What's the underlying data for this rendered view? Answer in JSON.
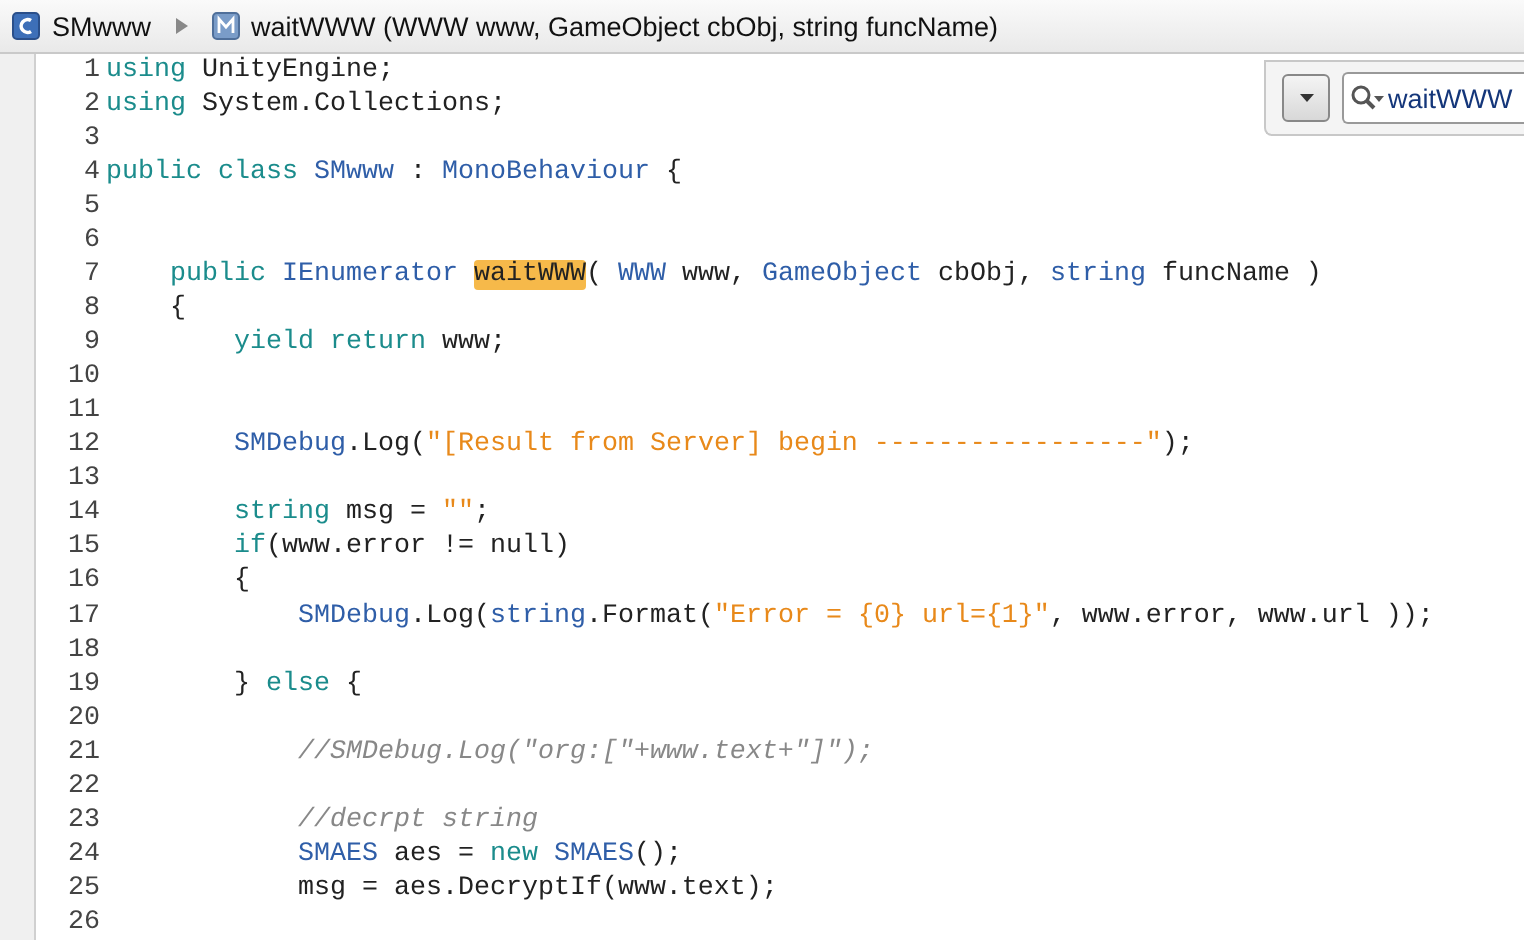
{
  "breadcrumb": {
    "class_name": "SMwww",
    "method_signature": "waitWWW (WWW www, GameObject cbObj, string funcName)"
  },
  "search": {
    "value": "waitWWW"
  },
  "lines": [
    {
      "number": "1",
      "tokens": [
        {
          "text": "using",
          "kind": "keyword"
        },
        {
          "text": " UnityEngine;",
          "kind": "plain"
        }
      ]
    },
    {
      "number": "2",
      "tokens": [
        {
          "text": "using",
          "kind": "keyword"
        },
        {
          "text": " System.Collections;",
          "kind": "plain"
        }
      ]
    },
    {
      "number": "3"
    },
    {
      "number": "4",
      "tokens": [
        {
          "text": "public class ",
          "kind": "keyword"
        },
        {
          "text": "SMwww",
          "kind": "type"
        },
        {
          "text": " : ",
          "kind": "plain"
        },
        {
          "text": "MonoBehaviour",
          "kind": "type"
        },
        {
          "text": " {",
          "kind": "plain"
        }
      ]
    },
    {
      "number": "5"
    },
    {
      "number": "6"
    },
    {
      "number": "7",
      "tokens": [
        {
          "text": "    public ",
          "kind": "keyword"
        },
        {
          "text": "IEnumerator ",
          "kind": "type"
        },
        {
          "text": "waitWWW",
          "kind": "match"
        },
        {
          "text": "( ",
          "kind": "plain"
        },
        {
          "text": "WWW",
          "kind": "type"
        },
        {
          "text": " www, ",
          "kind": "plain"
        },
        {
          "text": "GameObject",
          "kind": "type"
        },
        {
          "text": " cbObj, ",
          "kind": "plain"
        },
        {
          "text": "string",
          "kind": "type"
        },
        {
          "text": " funcName )",
          "kind": "plain"
        }
      ]
    },
    {
      "number": "8",
      "tokens": [
        {
          "text": "    {",
          "kind": "plain"
        }
      ]
    },
    {
      "number": "9",
      "tokens": [
        {
          "text": "        yield return",
          "kind": "keyword"
        },
        {
          "text": " www;",
          "kind": "plain"
        }
      ]
    },
    {
      "number": "10"
    },
    {
      "number": "11"
    },
    {
      "number": "12",
      "tokens": [
        {
          "text": "        SMDebug",
          "kind": "type"
        },
        {
          "text": ".Log(",
          "kind": "plain"
        },
        {
          "text": "\"[Result from Server] begin -----------------\"",
          "kind": "string"
        },
        {
          "text": ");",
          "kind": "plain"
        }
      ]
    },
    {
      "number": "13"
    },
    {
      "number": "14",
      "tokens": [
        {
          "text": "        string",
          "kind": "keyword"
        },
        {
          "text": " msg = ",
          "kind": "plain"
        },
        {
          "text": "\"\"",
          "kind": "string"
        },
        {
          "text": ";",
          "kind": "plain"
        }
      ]
    },
    {
      "number": "15",
      "tokens": [
        {
          "text": "        if",
          "kind": "keyword"
        },
        {
          "text": "(www.error != null)",
          "kind": "plain"
        }
      ]
    },
    {
      "number": "16",
      "tokens": [
        {
          "text": "        {",
          "kind": "plain"
        }
      ]
    },
    {
      "number": "17",
      "tokens": [
        {
          "text": "            SMDebug",
          "kind": "type"
        },
        {
          "text": ".Log(",
          "kind": "plain"
        },
        {
          "text": "string",
          "kind": "type"
        },
        {
          "text": ".Format(",
          "kind": "plain"
        },
        {
          "text": "\"Error = {0} url={1}\"",
          "kind": "string"
        },
        {
          "text": ", www.error, www.url ));",
          "kind": "plain"
        }
      ]
    },
    {
      "number": "18"
    },
    {
      "number": "19",
      "tokens": [
        {
          "text": "        } ",
          "kind": "plain"
        },
        {
          "text": "else",
          "kind": "keyword"
        },
        {
          "text": " {",
          "kind": "plain"
        }
      ]
    },
    {
      "number": "20"
    },
    {
      "number": "21",
      "tokens": [
        {
          "text": "            //SMDebug.Log(\"org:[\"+www.text+\"]\");",
          "kind": "comment"
        }
      ]
    },
    {
      "number": "22"
    },
    {
      "number": "23",
      "tokens": [
        {
          "text": "            //decrpt string",
          "kind": "comment"
        }
      ]
    },
    {
      "number": "24",
      "tokens": [
        {
          "text": "            SMAES",
          "kind": "type"
        },
        {
          "text": " aes = ",
          "kind": "plain"
        },
        {
          "text": "new ",
          "kind": "keyword"
        },
        {
          "text": "SMAES",
          "kind": "type"
        },
        {
          "text": "();",
          "kind": "plain"
        }
      ]
    },
    {
      "number": "25",
      "tokens": [
        {
          "text": "            msg = aes.DecryptIf(www.text);",
          "kind": "plain"
        }
      ]
    },
    {
      "number": "26"
    }
  ]
}
